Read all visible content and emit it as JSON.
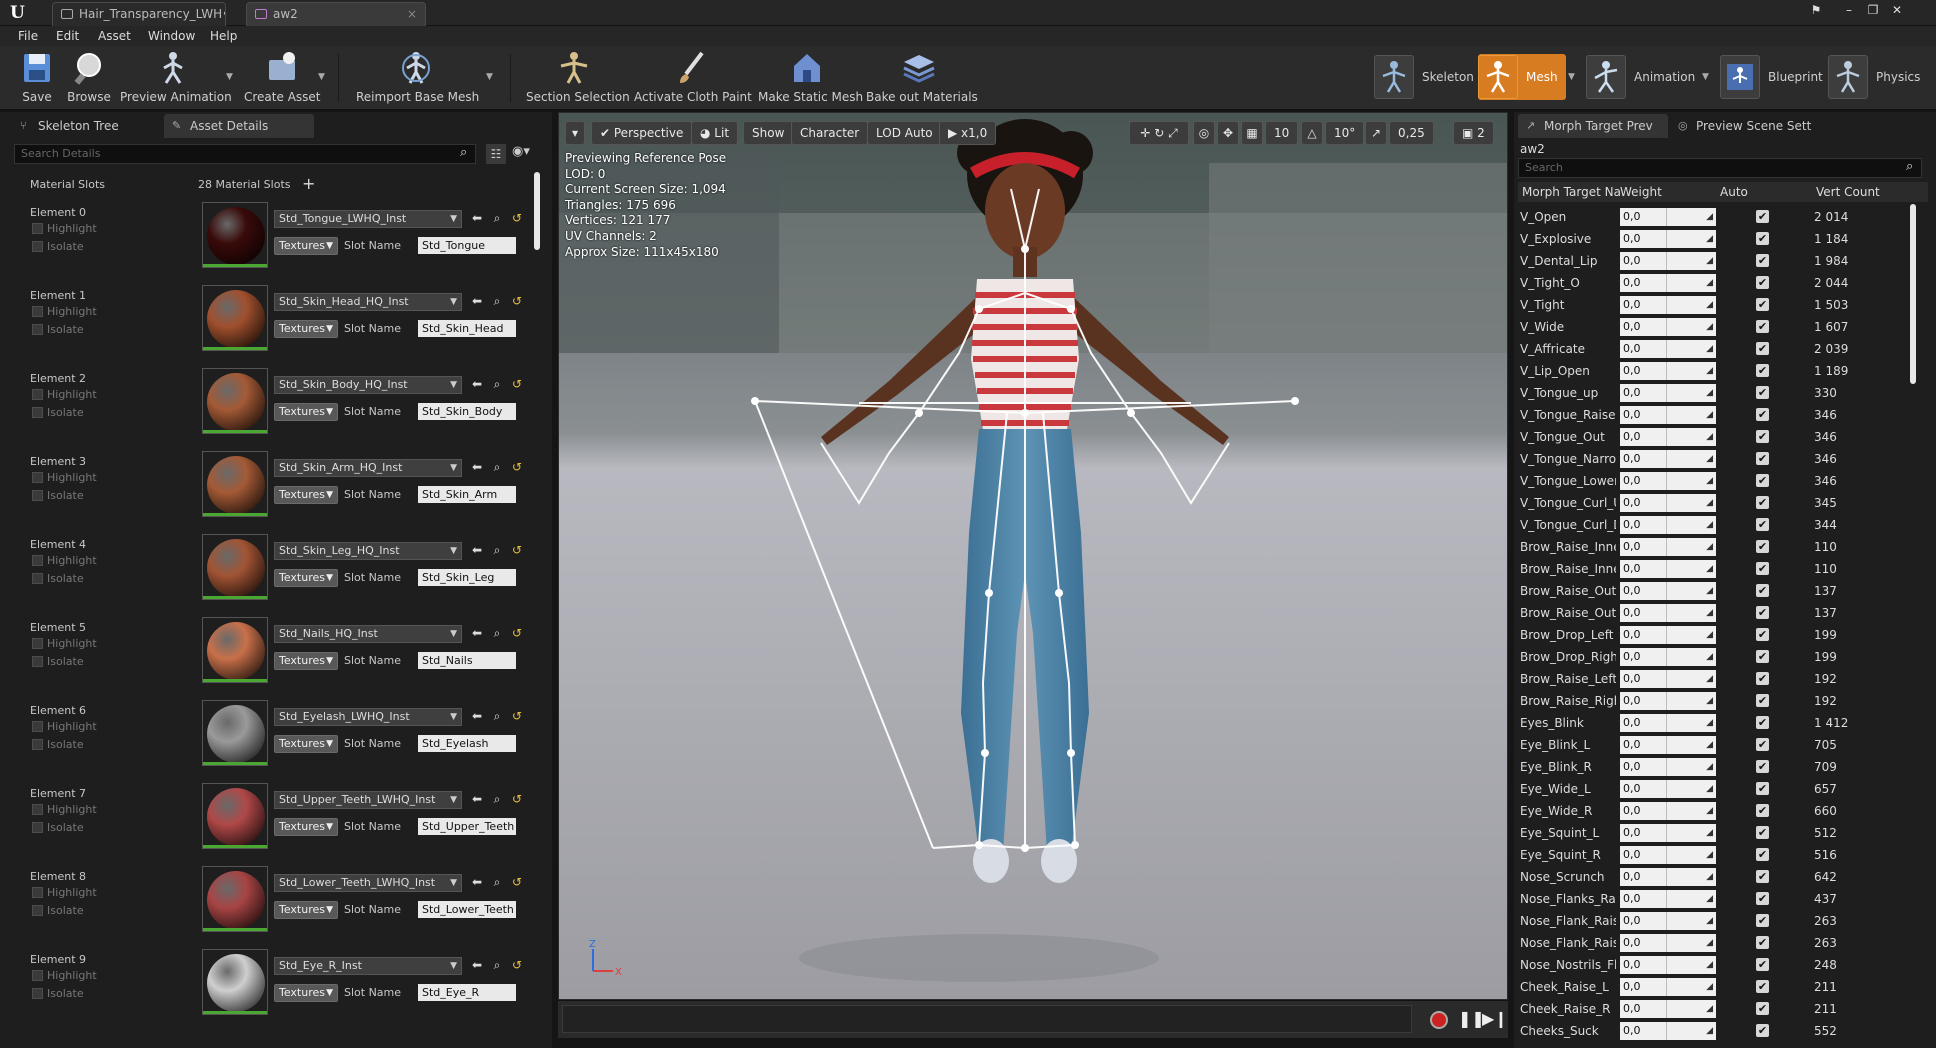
{
  "titlebar": {
    "tabs": [
      {
        "label": "Hair_Transparency_LWH•",
        "close": "×"
      },
      {
        "label": "aw2",
        "close": "×"
      }
    ]
  },
  "menu": [
    "File",
    "Edit",
    "Asset",
    "Window",
    "Help"
  ],
  "toolbar": {
    "buttons": [
      "Save",
      "Browse",
      "Preview Animation",
      "Create Asset",
      "Reimport Base Mesh",
      "Section Selection",
      "Activate Cloth Paint",
      "Make Static Mesh",
      "Bake out Materials"
    ],
    "modes": [
      "Skeleton",
      "Mesh",
      "Animation",
      "Blueprint",
      "Physics"
    ]
  },
  "left_panel": {
    "tabs": [
      "Skeleton Tree",
      "Asset Details"
    ],
    "search_placeholder": "Search Details",
    "material_slots_label": "Material Slots",
    "slot_count": "28 Material Slots",
    "highlight_label": "Highlight",
    "isolate_label": "Isolate",
    "textures_label": "Textures",
    "slot_name_label": "Slot Name",
    "elements": [
      {
        "label": "Element 0",
        "material": "Std_Tongue_LWHQ_Inst",
        "slot": "Std_Tongue",
        "color": "#3a0a0a"
      },
      {
        "label": "Element 1",
        "material": "Std_Skin_Head_HQ_Inst",
        "slot": "Std_Skin_Head",
        "color": "#a0502e"
      },
      {
        "label": "Element 2",
        "material": "Std_Skin_Body_HQ_Inst",
        "slot": "Std_Skin_Body",
        "color": "#a45a36"
      },
      {
        "label": "Element 3",
        "material": "Std_Skin_Arm_HQ_Inst",
        "slot": "Std_Skin_Arm",
        "color": "#a45a36"
      },
      {
        "label": "Element 4",
        "material": "Std_Skin_Leg_HQ_Inst",
        "slot": "Std_Skin_Leg",
        "color": "#a25434"
      },
      {
        "label": "Element 5",
        "material": "Std_Nails_HQ_Inst",
        "slot": "Std_Nails",
        "color": "#c8704a"
      },
      {
        "label": "Element 6",
        "material": "Std_Eyelash_LWHQ_Inst",
        "slot": "Std_Eyelash",
        "color": "#9a9a9a"
      },
      {
        "label": "Element 7",
        "material": "Std_Upper_Teeth_LWHQ_Inst",
        "slot": "Std_Upper_Teeth",
        "color": "#b04848"
      },
      {
        "label": "Element 8",
        "material": "Std_Lower_Teeth_LWHQ_Inst",
        "slot": "Std_Lower_Teeth",
        "color": "#a84444"
      },
      {
        "label": "Element 9",
        "material": "Std_Eye_R_Inst",
        "slot": "Std_Eye_R",
        "color": "#cfcfcf"
      }
    ]
  },
  "viewport": {
    "buttons": [
      "Perspective",
      "Lit",
      "Show",
      "Character",
      "LOD Auto",
      "x1,0"
    ],
    "grid_value": "10",
    "angle_value": "10°",
    "scale_value": "0,25",
    "camera_speed": "2",
    "info": [
      "Previewing Reference Pose",
      "LOD: 0",
      "Current Screen Size: 1,094",
      "Triangles: 175 696",
      "Vertices: 121 177",
      "UV Channels: 2",
      "Approx Size: 111x45x180"
    ]
  },
  "right_panel": {
    "tabs": [
      "Morph Target Prev",
      "Preview Scene Sett"
    ],
    "asset_name": "aw2",
    "search_placeholder": "Search",
    "columns": [
      "Morph Target Na",
      "Weight",
      "Auto",
      "Vert Count"
    ],
    "checkmark": "✔",
    "rows": [
      {
        "name": "V_Open",
        "weight": "0,0",
        "count": "2 014"
      },
      {
        "name": "V_Explosive",
        "weight": "0,0",
        "count": "1 184"
      },
      {
        "name": "V_Dental_Lip",
        "weight": "0,0",
        "count": "1 984"
      },
      {
        "name": "V_Tight_O",
        "weight": "0,0",
        "count": "2 044"
      },
      {
        "name": "V_Tight",
        "weight": "0,0",
        "count": "1 503"
      },
      {
        "name": "V_Wide",
        "weight": "0,0",
        "count": "1 607"
      },
      {
        "name": "V_Affricate",
        "weight": "0,0",
        "count": "2 039"
      },
      {
        "name": "V_Lip_Open",
        "weight": "0,0",
        "count": "1 189"
      },
      {
        "name": "V_Tongue_up",
        "weight": "0,0",
        "count": "330"
      },
      {
        "name": "V_Tongue_Raise",
        "weight": "0,0",
        "count": "346"
      },
      {
        "name": "V_Tongue_Out",
        "weight": "0,0",
        "count": "346"
      },
      {
        "name": "V_Tongue_Narrow",
        "weight": "0,0",
        "count": "346"
      },
      {
        "name": "V_Tongue_Lower",
        "weight": "0,0",
        "count": "346"
      },
      {
        "name": "V_Tongue_Curl_U",
        "weight": "0,0",
        "count": "345"
      },
      {
        "name": "V_Tongue_Curl_D",
        "weight": "0,0",
        "count": "344"
      },
      {
        "name": "Brow_Raise_Inner",
        "weight": "0,0",
        "count": "110"
      },
      {
        "name": "Brow_Raise_Inner",
        "weight": "0,0",
        "count": "110"
      },
      {
        "name": "Brow_Raise_Outer",
        "weight": "0,0",
        "count": "137"
      },
      {
        "name": "Brow_Raise_Outer",
        "weight": "0,0",
        "count": "137"
      },
      {
        "name": "Brow_Drop_Left",
        "weight": "0,0",
        "count": "199"
      },
      {
        "name": "Brow_Drop_Right",
        "weight": "0,0",
        "count": "199"
      },
      {
        "name": "Brow_Raise_Left",
        "weight": "0,0",
        "count": "192"
      },
      {
        "name": "Brow_Raise_Right",
        "weight": "0,0",
        "count": "192"
      },
      {
        "name": "Eyes_Blink",
        "weight": "0,0",
        "count": "1 412"
      },
      {
        "name": "Eye_Blink_L",
        "weight": "0,0",
        "count": "705"
      },
      {
        "name": "Eye_Blink_R",
        "weight": "0,0",
        "count": "709"
      },
      {
        "name": "Eye_Wide_L",
        "weight": "0,0",
        "count": "657"
      },
      {
        "name": "Eye_Wide_R",
        "weight": "0,0",
        "count": "660"
      },
      {
        "name": "Eye_Squint_L",
        "weight": "0,0",
        "count": "512"
      },
      {
        "name": "Eye_Squint_R",
        "weight": "0,0",
        "count": "516"
      },
      {
        "name": "Nose_Scrunch",
        "weight": "0,0",
        "count": "642"
      },
      {
        "name": "Nose_Flanks_Raise",
        "weight": "0,0",
        "count": "437"
      },
      {
        "name": "Nose_Flank_Raise",
        "weight": "0,0",
        "count": "263"
      },
      {
        "name": "Nose_Flank_Raise",
        "weight": "0,0",
        "count": "263"
      },
      {
        "name": "Nose_Nostrils_Flare",
        "weight": "0,0",
        "count": "248"
      },
      {
        "name": "Cheek_Raise_L",
        "weight": "0,0",
        "count": "211"
      },
      {
        "name": "Cheek_Raise_R",
        "weight": "0,0",
        "count": "211"
      },
      {
        "name": "Cheeks_Suck",
        "weight": "0,0",
        "count": "552"
      }
    ]
  },
  "colors": {
    "accent_active_mode": "#d87c22",
    "progress_green": "#4aa832",
    "record_red": "#cc2222"
  }
}
